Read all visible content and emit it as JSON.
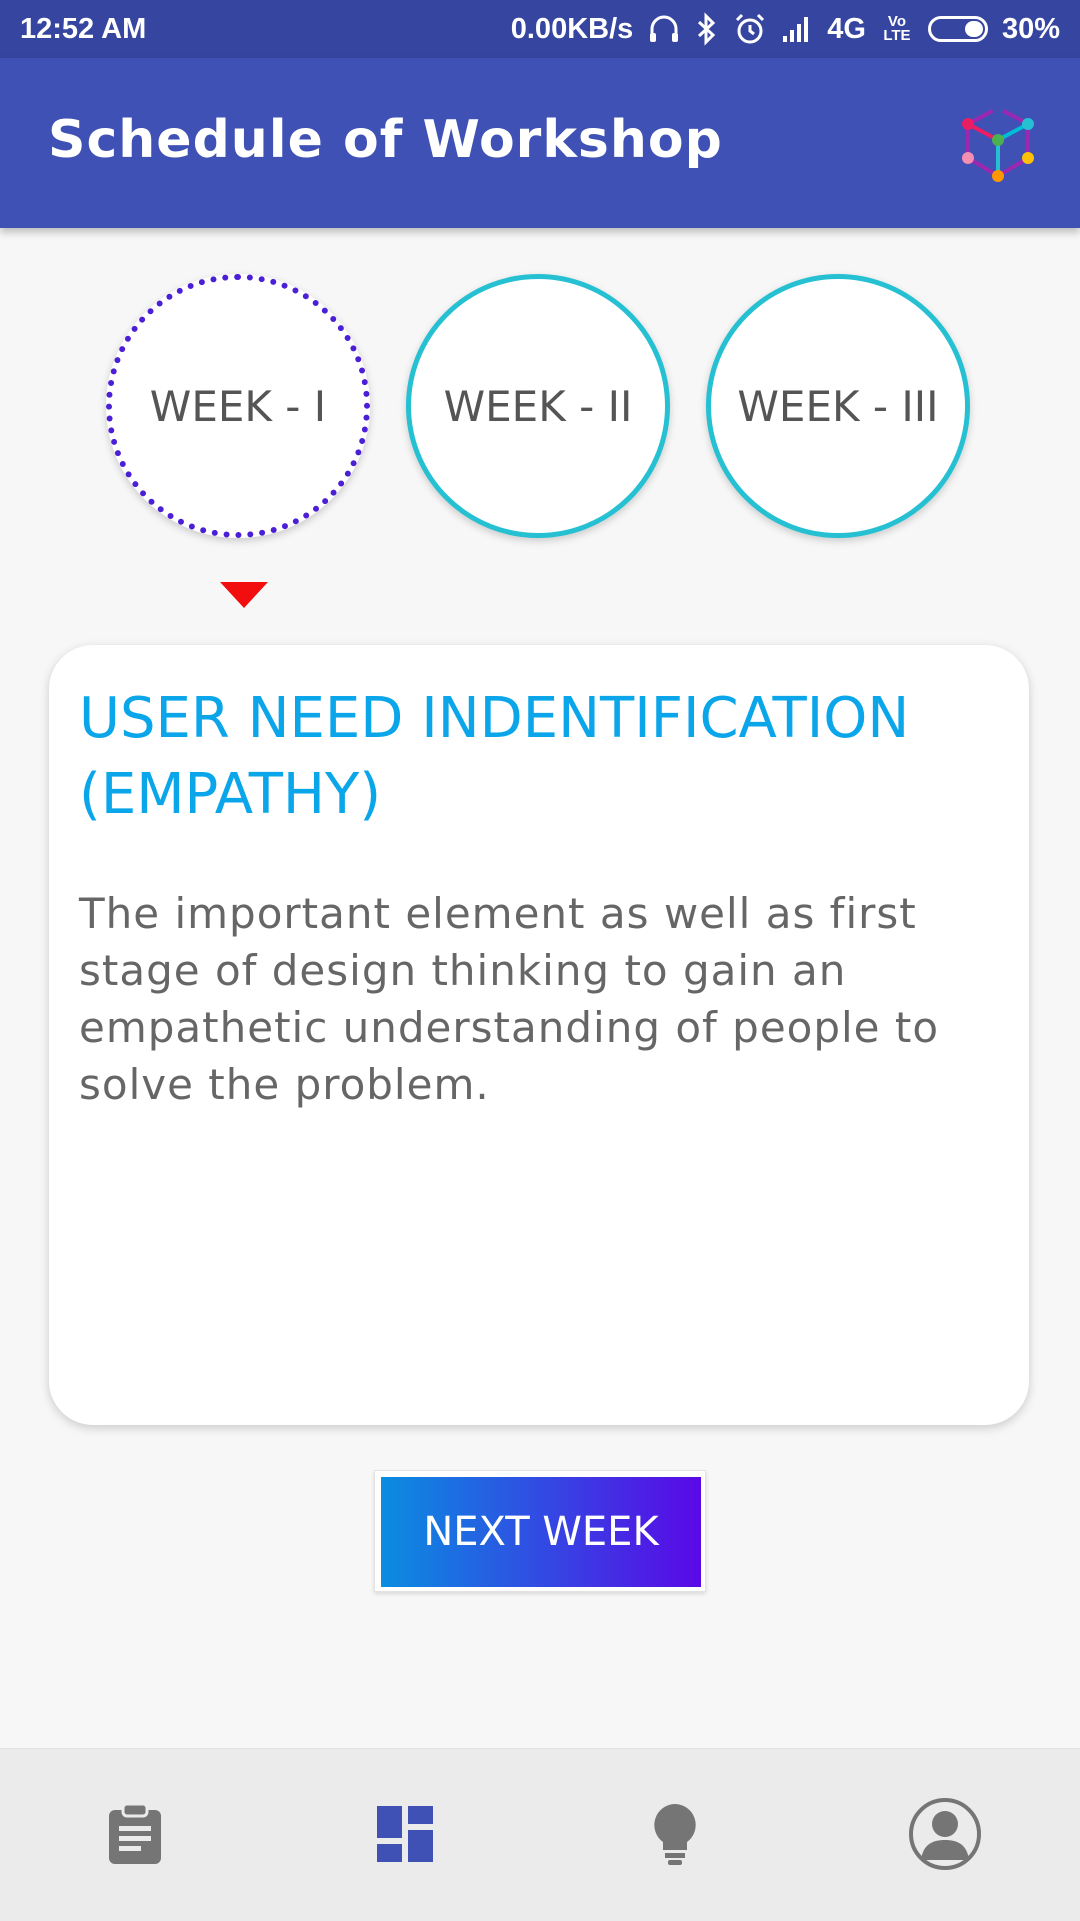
{
  "status_bar": {
    "time": "12:52 AM",
    "data_rate": "0.00KB/s",
    "network": "4G",
    "volte": "Vo LTE",
    "battery": "30%"
  },
  "app_bar": {
    "title": "Schedule of Workshop",
    "logo_icon": "cube-network-logo"
  },
  "weeks": [
    {
      "label": "WEEK - I",
      "selected": true
    },
    {
      "label": "WEEK - II",
      "selected": false
    },
    {
      "label": "WEEK - III",
      "selected": false
    }
  ],
  "card": {
    "title": "USER NEED INDENTIFICATION (EMPATHY)",
    "body": "The important element as well as first stage of design thinking to gain an empathetic understanding of people to solve the problem."
  },
  "next_button": {
    "label": "NEXT WEEK"
  },
  "bottom_nav": [
    {
      "icon": "clipboard-icon",
      "active": false
    },
    {
      "icon": "dashboard-icon",
      "active": true
    },
    {
      "icon": "lightbulb-icon",
      "active": false
    },
    {
      "icon": "profile-icon",
      "active": false
    }
  ],
  "colors": {
    "app_bar": "#3f51b5",
    "status_bar": "#3646a0",
    "accent_cyan": "#26c0d3",
    "active_week_border": "#4a1fd6",
    "title_blue": "#0ba6ea",
    "pointer_red": "#f20e0e",
    "nav_active": "#3f51b5",
    "nav_inactive": "#757575"
  }
}
